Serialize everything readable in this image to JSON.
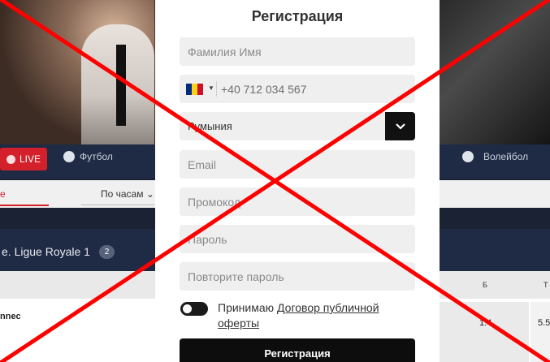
{
  "background": {
    "sports_nav": {
      "live": "LIVE",
      "items": [
        "Футбол",
        "Волейбол"
      ]
    },
    "filter": {
      "active_partial": "е",
      "sort_label": "По часам"
    },
    "league": {
      "title": "e. Ligue Royale 1",
      "count": "2"
    },
    "table": {
      "header_b": "Б",
      "header_t": "Т",
      "row_team": "nnec",
      "odd1": "1.4",
      "odd2": "5.5"
    }
  },
  "modal": {
    "title": "Регистрация",
    "name_placeholder": "Фамилия Имя",
    "phone_value": "+40 712 034 567",
    "currency_value": "Румыния",
    "email_placeholder": "Email",
    "promo_placeholder": "Промокод",
    "password_placeholder": "Пароль",
    "repeat_password_placeholder": "Повторите пароль",
    "agree_text": "Принимаю ",
    "agree_link": "Договор публичной оферты",
    "submit_label": "Регистрация"
  },
  "colors": {
    "cross": "#ff0000",
    "accent": "#d3202a"
  },
  "icons": {
    "flag": "romania-flag-icon",
    "dropdown": "chevron-down-icon",
    "football": "soccer-ball-icon",
    "volleyball": "volleyball-icon"
  }
}
